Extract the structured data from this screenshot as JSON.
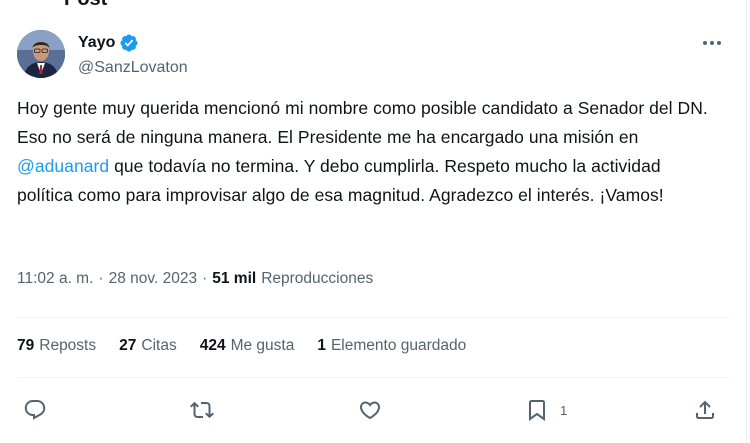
{
  "header": {
    "title": "Post"
  },
  "author": {
    "display_name": "Yayo",
    "handle": "@SanzLovaton",
    "verified_color": "#1d9bf0"
  },
  "tweet": {
    "text_before_mention": "Hoy gente muy querida mencionó mi nombre como posible candidato a Senador del DN. Eso no será de ninguna manera. El Presidente me ha encargado una misión en ",
    "mention": "@aduanard",
    "text_after_mention": " que todavía no termina. Y debo cumplirla. Respeto mucho la actividad política como para improvisar algo de esa magnitud. Agradezco el interés. ¡Vamos!"
  },
  "meta": {
    "time": "11:02 a. m.",
    "separator": "·",
    "date": "28 nov. 2023",
    "separator2": "·",
    "views_count": "51 mil",
    "views_label": "Reproducciones"
  },
  "stats": {
    "reposts_count": "79",
    "reposts_label": "Reposts",
    "quotes_count": "27",
    "quotes_label": "Citas",
    "likes_count": "424",
    "likes_label": "Me gusta",
    "bookmarks_count": "1",
    "bookmarks_label": "Elemento guardado"
  },
  "actions": {
    "bookmark_count": "1"
  },
  "colors": {
    "text": "#0f1419",
    "secondary": "#536471",
    "accent": "#1d9bf0",
    "border": "#eff3f4"
  }
}
